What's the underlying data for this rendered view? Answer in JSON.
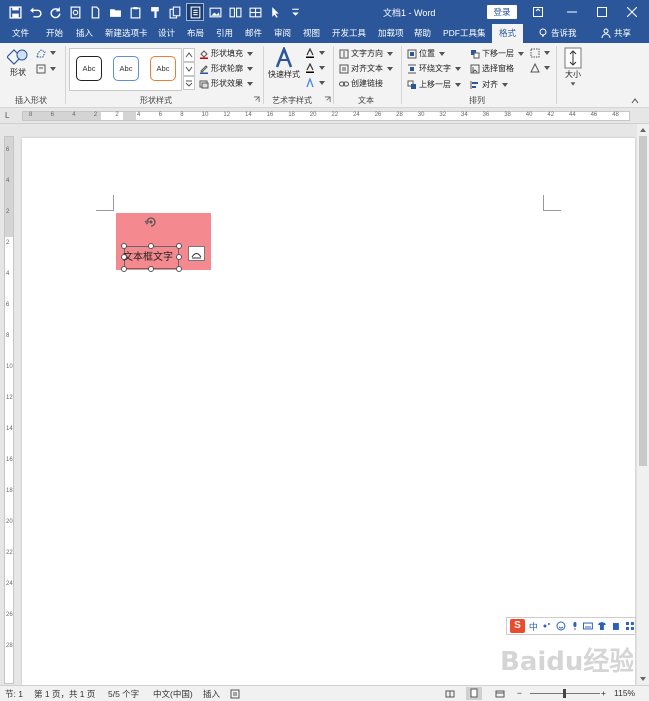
{
  "window": {
    "title": "文档1 - Word",
    "login_label": "登录"
  },
  "tabs": [
    {
      "id": "file",
      "label": "文件"
    },
    {
      "id": "home",
      "label": "开始"
    },
    {
      "id": "insert",
      "label": "插入"
    },
    {
      "id": "newtab",
      "label": "新建选项卡"
    },
    {
      "id": "design",
      "label": "设计"
    },
    {
      "id": "layout",
      "label": "布局"
    },
    {
      "id": "references",
      "label": "引用"
    },
    {
      "id": "mailings",
      "label": "邮件"
    },
    {
      "id": "review",
      "label": "审阅"
    },
    {
      "id": "view",
      "label": "视图"
    },
    {
      "id": "developer",
      "label": "开发工具"
    },
    {
      "id": "addins",
      "label": "加载项"
    },
    {
      "id": "help",
      "label": "帮助"
    },
    {
      "id": "pdf",
      "label": "PDF工具集"
    },
    {
      "id": "format",
      "label": "格式",
      "active": true
    }
  ],
  "tell_me": "告诉我",
  "share": "共享",
  "ribbon": {
    "insert_shapes": {
      "group_label": "插入形状",
      "shapes_label": "形状"
    },
    "shape_styles": {
      "group_label": "形状样式",
      "gallery": [
        "Abc",
        "Abc",
        "Abc"
      ],
      "fill": "形状填充",
      "outline": "形状轮廓",
      "effects": "形状效果"
    },
    "wordart": {
      "group_label": "艺术字样式",
      "quick_styles": "快速样式"
    },
    "text": {
      "group_label": "文本",
      "direction": "文字方向",
      "align": "对齐文本",
      "link": "创建链接"
    },
    "arrange": {
      "group_label": "排列",
      "position": "位置",
      "wrap": "环绕文字",
      "forward": "上移一层",
      "backward": "下移一层",
      "selection_pane": "选择窗格",
      "align": "对齐"
    },
    "size": {
      "label": "大小"
    }
  },
  "ruler": {
    "h_ticks": [
      "8",
      "6",
      "4",
      "2",
      "2",
      "4",
      "6",
      "8",
      "10",
      "12",
      "14",
      "16",
      "18",
      "20",
      "22",
      "24",
      "26",
      "28",
      "30",
      "32",
      "34",
      "36",
      "38",
      "40",
      "42",
      "44",
      "46",
      "48"
    ],
    "v_ticks": [
      "6",
      "4",
      "2",
      "2",
      "4",
      "6",
      "8",
      "10",
      "12",
      "14",
      "16",
      "18",
      "20",
      "22",
      "24",
      "26",
      "28"
    ]
  },
  "document": {
    "textbox_text": "文本框文字",
    "textbox_fill": "#f48a8f"
  },
  "ime": {
    "logo": "S",
    "mode": "中"
  },
  "watermark": "Baidu经验",
  "status": {
    "section": "节: 1",
    "page": "第 1 页，共 1 页",
    "words": "5/5 个字",
    "language": "中文(中国)",
    "mode": "插入",
    "zoom": "115%"
  },
  "colors": {
    "title_bar": "#2b579a",
    "ribbon_bg": "#f3f3f3",
    "accent": "#2b579a"
  }
}
